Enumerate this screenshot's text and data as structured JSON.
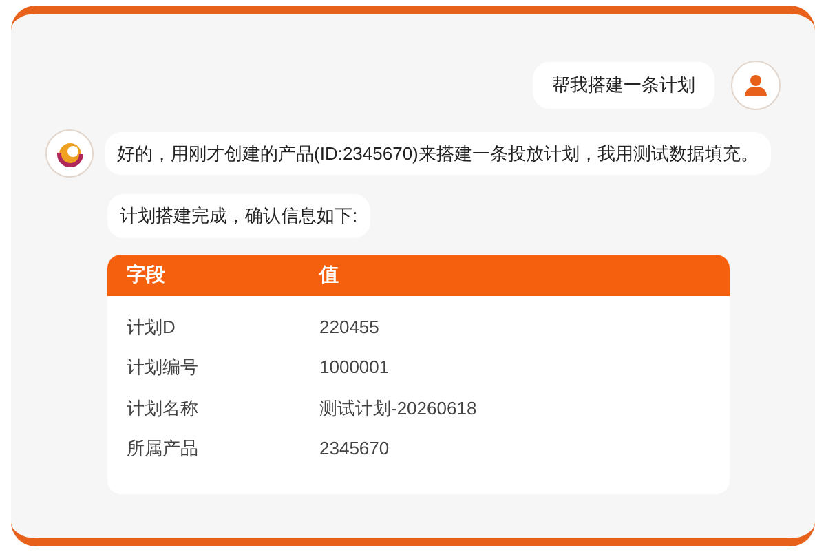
{
  "messages": [
    {
      "kind": "user",
      "text": "帮我搭建一条计划"
    },
    {
      "kind": "assistant",
      "text": "好的，用刚才创建的产品(ID:2345670)来搭建一条投放计划，我用测试数据填充。"
    }
  ],
  "summary": "计划搭建完成，确认信息如下:",
  "table": {
    "columns": [
      "字段",
      "值"
    ],
    "rows": [
      [
        "计划D",
        "220455"
      ],
      [
        "计划编号",
        "1000001"
      ],
      [
        "计划名称",
        "测试计划-20260618"
      ],
      [
        "所属产品",
        "2345670"
      ]
    ]
  }
}
